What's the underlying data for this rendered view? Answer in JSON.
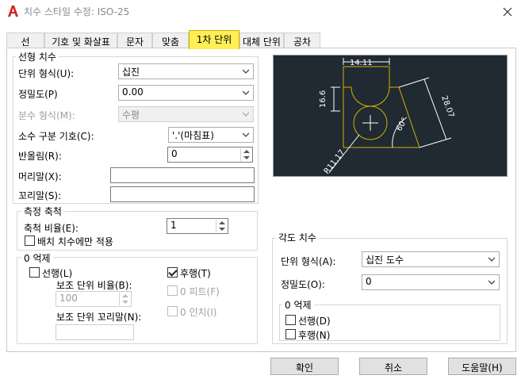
{
  "window": {
    "title": "치수 스타일 수정: ISO-25",
    "close_glyph": "✕"
  },
  "tabs": [
    {
      "label": "선"
    },
    {
      "label": "기호 및 화살표"
    },
    {
      "label": "문자"
    },
    {
      "label": "맞춤"
    },
    {
      "label": "1차 단위"
    },
    {
      "label": "대체 단위"
    },
    {
      "label": "공차"
    }
  ],
  "linear": {
    "group_title": "선형 치수",
    "unit_format_label": "단위 형식(U):",
    "unit_format_value": "십진",
    "precision_label": "정밀도(P)",
    "precision_value": "0.00",
    "fraction_format_label": "분수 형식(M):",
    "fraction_format_value": "수평",
    "decimal_sep_label": "소수 구분 기호(C):",
    "decimal_sep_value": "'.'(마침표)",
    "round_off_label": "반올림(R):",
    "round_off_value": "0",
    "prefix_label": "머리말(X):",
    "prefix_value": "",
    "suffix_label": "꼬리말(S):",
    "suffix_value": ""
  },
  "measurement_scale": {
    "group_title": "측정 축척",
    "scale_factor_label": "축척 비율(E):",
    "scale_factor_value": "1",
    "layout_only_label": "배치 치수에만 적용"
  },
  "zero_suppression": {
    "group_title": "0 억제",
    "leading_label": "선행(L)",
    "leading_checked": false,
    "trailing_label": "후행(T)",
    "trailing_checked": true,
    "sub_units_factor_label": "보조 단위 비율(B):",
    "sub_units_factor_value": "100",
    "sub_units_suffix_label": "보조 단위 꼬리말(N):",
    "sub_units_suffix_value": "",
    "feet_label": "0 피트(F)",
    "inches_label": "0 인치(I)"
  },
  "angular": {
    "group_title": "각도 치수",
    "unit_format_label": "단위 형식(A):",
    "unit_format_value": "십진 도수",
    "precision_label": "정밀도(O):",
    "precision_value": "0",
    "zero_group_title": "0 억제",
    "leading_label": "선행(D)",
    "trailing_label": "후행(N)"
  },
  "preview": {
    "dim_top": "14.11",
    "dim_left": "16.6",
    "dim_right": "28.07",
    "dim_angle": "60°",
    "dim_radius": "R11.17"
  },
  "buttons": {
    "ok": "확인",
    "cancel": "취소",
    "help": "도움말(H)"
  },
  "colors": {
    "active_tab": "#ffee55",
    "preview_bg": "#1f2a33",
    "preview_geometry": "#d4b000",
    "preview_dims": "#ffffff",
    "app_icon": "#d42020"
  }
}
